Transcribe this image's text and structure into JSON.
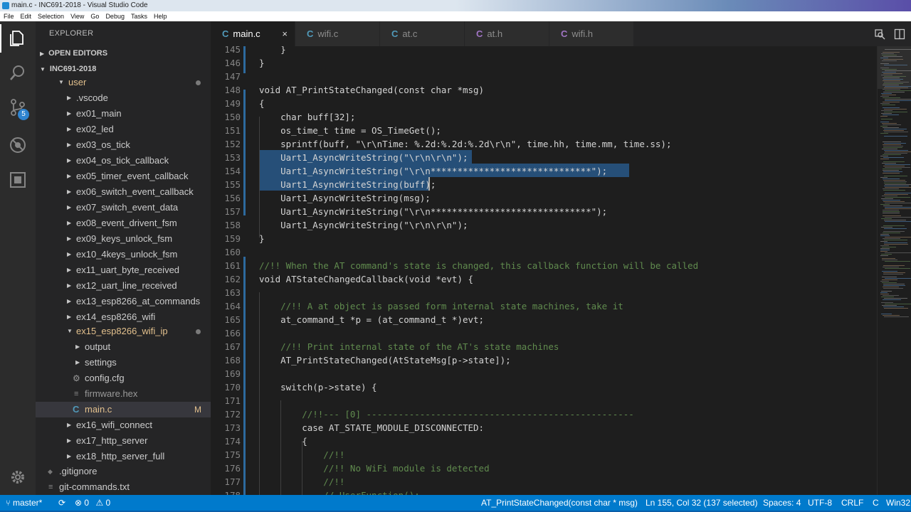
{
  "titlebar": {
    "title": "main.c - INC691-2018 - Visual Studio Code"
  },
  "menu": [
    "File",
    "Edit",
    "Selection",
    "View",
    "Go",
    "Debug",
    "Tasks",
    "Help"
  ],
  "activity": {
    "scm_badge": "5"
  },
  "explorer": {
    "title": "EXPLORER",
    "open_editors": "OPEN EDITORS",
    "workspace": "INC691-2018",
    "items": [
      ".vscode",
      "ex01_main",
      "ex02_led",
      "ex03_os_tick",
      "ex04_os_tick_callback",
      "ex05_timer_event_callback",
      "ex06_switch_event_callback",
      "ex07_switch_event_data",
      "ex08_event_drivent_fsm",
      "ex09_keys_unlock_fsm",
      "ex10_4keys_unlock_fsm",
      "ex11_uart_byte_received",
      "ex12_uart_line_received",
      "ex13_esp8266_at_commands",
      "ex14_esp8266_wifi",
      "ex15_esp8266_wifi_ip"
    ],
    "user_folder": "user",
    "ex15_children": [
      "output",
      "settings",
      "config.cfg",
      "firmware.hex",
      "main.c"
    ],
    "c_icon": "C",
    "main_flag": "M",
    "after_items": [
      "ex16_wifi_connect",
      "ex17_http_server",
      "ex18_http_server_full"
    ],
    "root_files": [
      ".gitignore",
      "git-commands.txt"
    ]
  },
  "tabs": [
    {
      "label": "main.c",
      "icon": "C"
    },
    {
      "label": "wifi.c",
      "icon": "C"
    },
    {
      "label": "at.c",
      "icon": "C"
    },
    {
      "label": "at.h",
      "icon": "C"
    },
    {
      "label": "wifi.h",
      "icon": "C"
    }
  ],
  "tab_close": "×",
  "editor": {
    "line_numbers": [
      "145",
      "146",
      "147",
      "148",
      "149",
      "150",
      "151",
      "152",
      "153",
      "154",
      "155",
      "156",
      "157",
      "158",
      "159",
      "160",
      "161",
      "162",
      "163",
      "164",
      "165",
      "166",
      "167",
      "168",
      "169",
      "170",
      "171",
      "172",
      "173",
      "174",
      "175",
      "176",
      "177",
      "178"
    ],
    "lines": [
      "    }",
      "}",
      "",
      "void AT_PrintStateChanged(const char *msg)",
      "{",
      "    char buff[32];",
      "    os_time_t time = OS_TimeGet();",
      "    sprintf(buff, \"\\r\\nTime: %.2d:%.2d:%.2d\\r\\n\", time.hh, time.mm, time.ss);",
      "    Uart1_AsyncWriteString(\"\\r\\n\\r\\n\");",
      "    Uart1_AsyncWriteString(\"\\r\\n******************************\");",
      "    Uart1_AsyncWriteString(buff);",
      "    Uart1_AsyncWriteString(msg);",
      "    Uart1_AsyncWriteString(\"\\r\\n******************************\");",
      "    Uart1_AsyncWriteString(\"\\r\\n\\r\\n\");",
      "}",
      "",
      "//!! When the AT command's state is changed, this callback function will be called",
      "void ATStateChangedCallback(void *evt) {",
      "",
      "    //!! A at object is passed form internal state machines, take it",
      "    at_command_t *p = (at_command_t *)evt;",
      "",
      "    //!! Print internal state of the AT's state machines",
      "    AT_PrintStateChanged(AtStateMsg[p->state]);",
      "",
      "    switch(p->state) {",
      "",
      "        //!!--- [0] --------------------------------------------------",
      "        case AT_STATE_MODULE_DISCONNECTED:",
      "        {",
      "            //!!",
      "            //!! No WiFi module is detected",
      "            //!!",
      "            // UserFunction();"
    ]
  },
  "status": {
    "branch": "master*",
    "errors": "0",
    "warnings": "0",
    "function": "AT_PrintStateChanged(const char * msg)",
    "position": "Ln 155, Col 32 (137 selected)",
    "spaces": "Spaces: 4",
    "encoding": "UTF-8",
    "eol": "CRLF",
    "language": "C",
    "platform": "Win32"
  },
  "colors": {
    "statusbar": "#007acc",
    "selection": "#264f78",
    "accent": "#519aba"
  }
}
